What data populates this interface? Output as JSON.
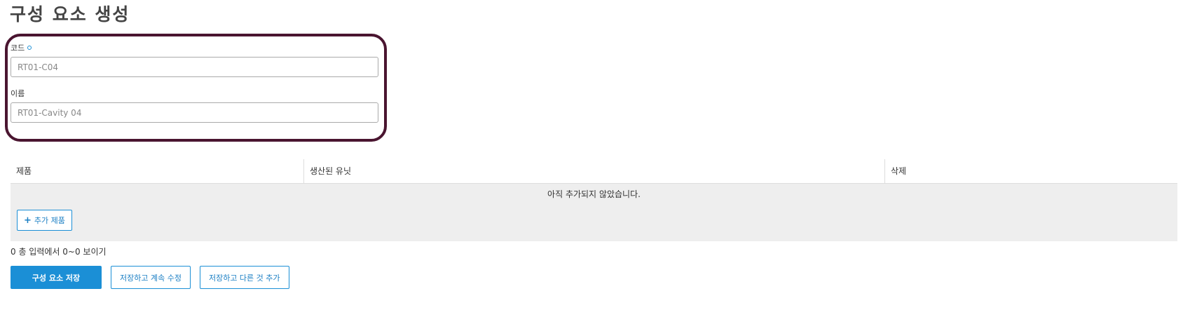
{
  "page_title": "구성 요소 생성",
  "form": {
    "code": {
      "label": "코드",
      "value": "RT01-C04"
    },
    "name": {
      "label": "이름",
      "value": "RT01-Cavity 04"
    }
  },
  "table": {
    "columns": [
      "제품",
      "생산된 유닛",
      "삭제"
    ],
    "empty_message": "아직 추가되지 않았습니다.",
    "add_button_label": "추가 제품"
  },
  "pagination_info": "0 총 입력에서 0~0 보이기",
  "actions": {
    "save_label": "구성 요소 저장",
    "save_continue_label": "저장하고 계속 수정",
    "save_add_another_label": "저장하고 다른 것 추가"
  },
  "colors": {
    "primary": "#1b8fd6",
    "highlight_border": "#4a1530",
    "table_empty_bg": "#eeeeee"
  },
  "icons": {
    "required": "required-dot-icon",
    "add": "plus-icon"
  }
}
